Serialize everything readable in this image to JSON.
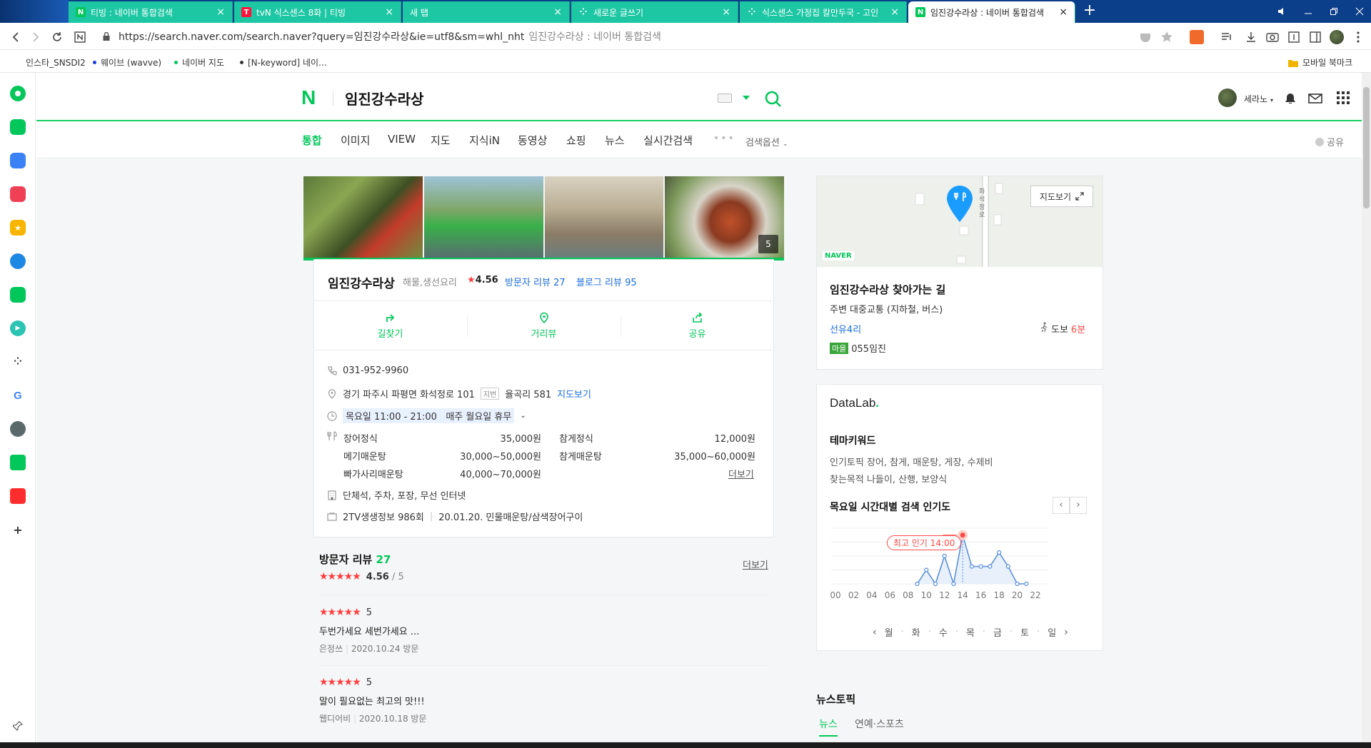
{
  "browser": {
    "tabs": [
      {
        "title": "티빙 : 네이버 통합검색",
        "favicon": "N",
        "favicon_color": "#03c75a"
      },
      {
        "title": "tvN 식스센스 8화 | 티빙",
        "favicon": "T",
        "favicon_color": "#ff153c"
      },
      {
        "title": "새 탭",
        "favicon": "",
        "favicon_color": "#1ec7a4"
      },
      {
        "title": "새로운 글쓰기",
        "favicon": "⁘",
        "favicon_color": "#1ec7a4"
      },
      {
        "title": "식스센스 가정집 칼만두국 - 고인",
        "favicon": "⁘",
        "favicon_color": "#1ec7a4"
      },
      {
        "title": "임진강수라상 : 네이버 통합검색",
        "favicon": "N",
        "favicon_color": "#03c75a"
      }
    ],
    "close_glyph": "×",
    "new_tab": "+",
    "url": "https://search.naver.com/search.naver?query=임진강수라상&ie=utf8&sm=whl_nht",
    "page_title": "임진강수라상 : 네이버 통합검색",
    "bookmarks": [
      {
        "label": "인스타_SNSDI2",
        "dot": ""
      },
      {
        "label": "웨이브 (wavve)",
        "dot": "#1a3ad9"
      },
      {
        "label": "네이버 지도",
        "dot": "#03c75a"
      },
      {
        "label": "[N-keyword] 네이...",
        "dot": "#333333"
      }
    ],
    "mobile_bookmarks": "모바일 북마크",
    "sidebar_icons": [
      "whale-icon",
      "chat-icon",
      "briefcase-icon",
      "pocket-icon",
      "star-icon",
      "edge-icon",
      "green-circle-icon",
      "play-icon",
      "dots-icon",
      "google-icon",
      "cat-icon",
      "webtoon-icon",
      "now-icon",
      "add-icon",
      "pin-icon"
    ]
  },
  "naver": {
    "logo": "N",
    "query": "임진강수라상",
    "user": "세라노",
    "tabs": [
      "통합",
      "이미지",
      "VIEW",
      "지도",
      "지식iN",
      "동영상",
      "쇼핑",
      "뉴스",
      "실시간검색"
    ],
    "more": "•••",
    "search_options": "검색옵션",
    "share": "공유"
  },
  "place": {
    "photo_count": "5",
    "name": "임진강수라상",
    "category": "해물,생선요리",
    "rating_star": "★",
    "rating": "4.56",
    "visitor_reviews": "방문자 리뷰 27",
    "blog_reviews": "블로그 리뷰 95",
    "actions": [
      "길찾기",
      "거리뷰",
      "공유"
    ],
    "phone": "031-952-9960",
    "address": "경기 파주시 파평면 화석정로 101",
    "jibeon_label": "지번",
    "jibeon": "율곡리 581",
    "map_link": "지도보기",
    "hours": "목요일 11:00 - 21:00",
    "holiday": "매주 월요일 휴무",
    "menu": [
      {
        "name": "장어정식",
        "price": "35,000원"
      },
      {
        "name": "참게정식",
        "price": "12,000원"
      },
      {
        "name": "메기매운탕",
        "price": "30,000~50,000원"
      },
      {
        "name": "참게매운탕",
        "price": "35,000~60,000원"
      },
      {
        "name": "빠가사리매운탕",
        "price": "40,000~70,000원"
      }
    ],
    "menu_more": "더보기",
    "facilities": "단체석, 주차, 포장, 무선 인터넷",
    "tv": "2TV생생정보 986회",
    "tv_detail": "20.01.20. 민물매운탕/삼색장어구이"
  },
  "reviews": {
    "title": "방문자 리뷰",
    "count": "27",
    "more": "더보기",
    "avg_stars": "★★★★★",
    "avg": "4.56",
    "avg_of": "/ 5",
    "items": [
      {
        "stars": "★★★★★",
        "score": "5",
        "text": "두번가세요 세번가세요 ...",
        "author": "은정쓰",
        "date": "2020.10.24 방문"
      },
      {
        "stars": "★★★★★",
        "score": "5",
        "text": "말이 필요없는 최고의 맛!!!",
        "author": "웹디어비",
        "date": "2020.10.18 방문"
      }
    ]
  },
  "map": {
    "view_button": "지도보기",
    "badge": "NAVER",
    "road_label": "화석정로",
    "directions_title": "임진강수라상 찾아가는 길",
    "directions_sub": "주변 대중교통 (지하철, 버스)",
    "bus_stop": "선유4리",
    "walk": "도보",
    "walk_min": "6분",
    "bus_badge": "마을",
    "bus_line": "055임진"
  },
  "datalab": {
    "logo": "DataLab",
    "logo_dot": ".",
    "theme_title": "테마키워드",
    "theme_lines": [
      "인기토픽 장어, 참게, 매운탕, 게장, 수제비",
      "찾는목적 나들이, 산행, 보양식"
    ],
    "popularity_title": "목요일 시간대별 검색 인기도",
    "prev": "‹",
    "next": "›",
    "peak_label": "최고 인기 14:00",
    "days": [
      "월",
      "화",
      "수",
      "목",
      "금",
      "토",
      "일"
    ]
  },
  "chart_data": {
    "type": "line",
    "x": [
      "00",
      "02",
      "04",
      "06",
      "08",
      "10",
      "12",
      "14",
      "16",
      "18",
      "20",
      "22"
    ],
    "x_hours": [
      9,
      10,
      11,
      12,
      13,
      14,
      15,
      16,
      17,
      18,
      19,
      20,
      21
    ],
    "values": [
      0,
      20,
      0,
      40,
      0,
      70,
      25,
      25,
      25,
      45,
      25,
      0,
      0
    ],
    "ylim": [
      0,
      80
    ],
    "peak_hour": 14,
    "grid": true,
    "line_color": "#5b8fdc",
    "peak_color": "#ff4a4a"
  },
  "news": {
    "title": "뉴스토픽",
    "tabs": [
      "뉴스",
      "연예·스포츠"
    ]
  }
}
